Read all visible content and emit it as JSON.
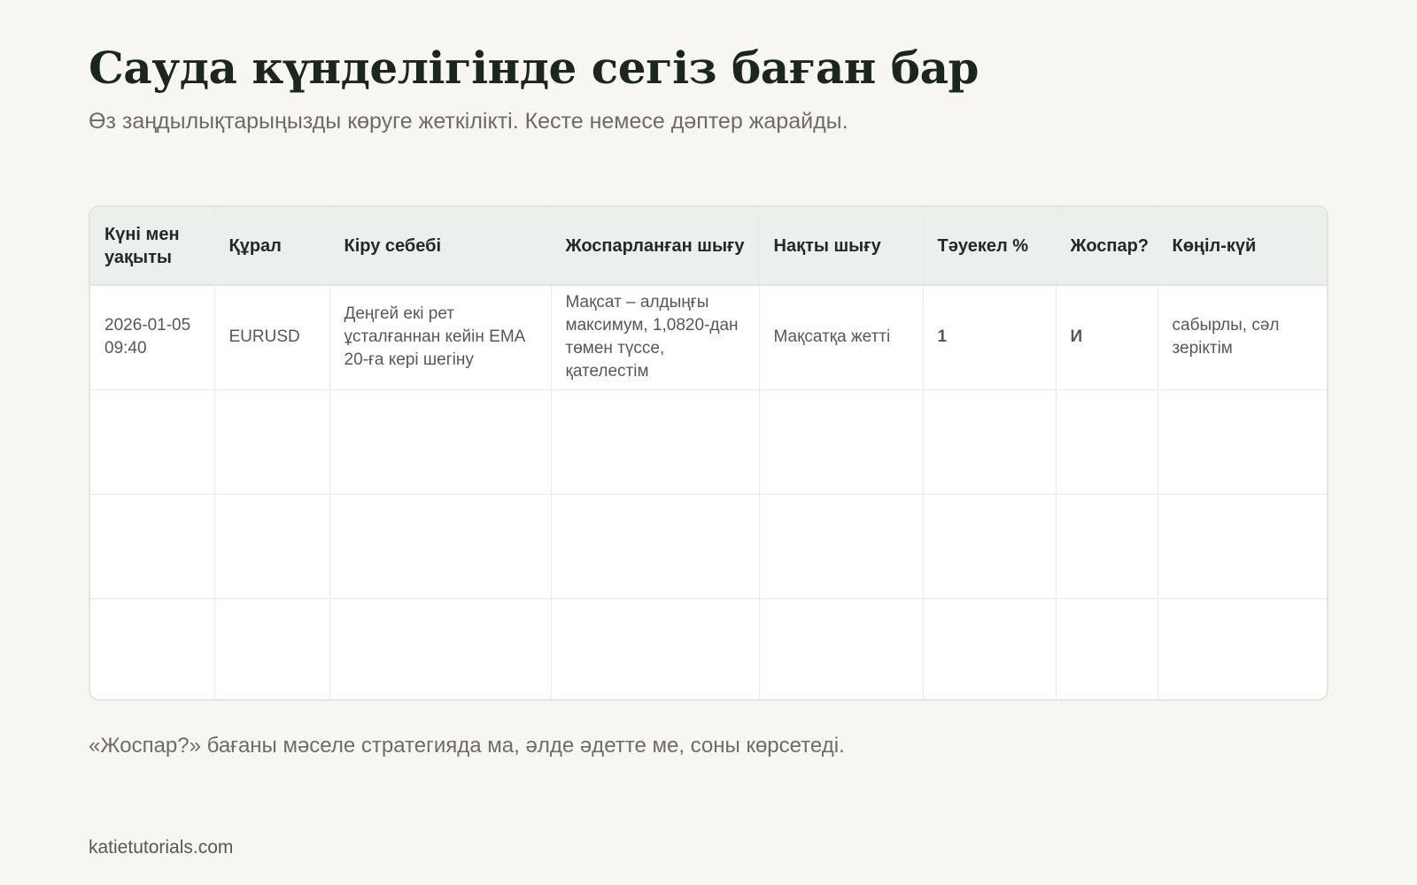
{
  "header": {
    "title": "Сауда күнделігінде сегіз баған бар",
    "subtitle": "Өз заңдылықтарыңызды көруге жеткілікті. Кесте немесе дәптер жарайды."
  },
  "table": {
    "columns": [
      "Күні мен уақыты",
      "Құрал",
      "Кіру себебі",
      "Жоспарланған шығу",
      "Нақты шығу",
      "Тәуекел %",
      "Жоспар?",
      "Көңіл-күй"
    ],
    "rows": [
      [
        "2026-01-05 09:40",
        "EURUSD",
        "Деңгей екі рет ұсталғаннан кейін EMA 20-ға кері шегіну",
        "Мақсат – алдыңғы максимум, 1,0820-дан төмен түссе, қателестім",
        "Мақсатқа жетті",
        "1",
        "И",
        "сабырлы, сәл зеріктім"
      ],
      [
        "",
        "",
        "",
        "",
        "",
        "",
        "",
        ""
      ],
      [
        "",
        "",
        "",
        "",
        "",
        "",
        "",
        ""
      ],
      [
        "",
        "",
        "",
        "",
        "",
        "",
        "",
        ""
      ]
    ]
  },
  "footnote": "«Жоспар?» бағаны мәселе стратегияда ма, әлде әдетте ме, соны көрсетеді.",
  "footer": {
    "site": "katietutorials.com"
  },
  "colors": {
    "background": "#f7f6f2",
    "header_row": "#ebf0ec",
    "plan_yes": "#1f8a5c",
    "title": "#1c2620"
  }
}
